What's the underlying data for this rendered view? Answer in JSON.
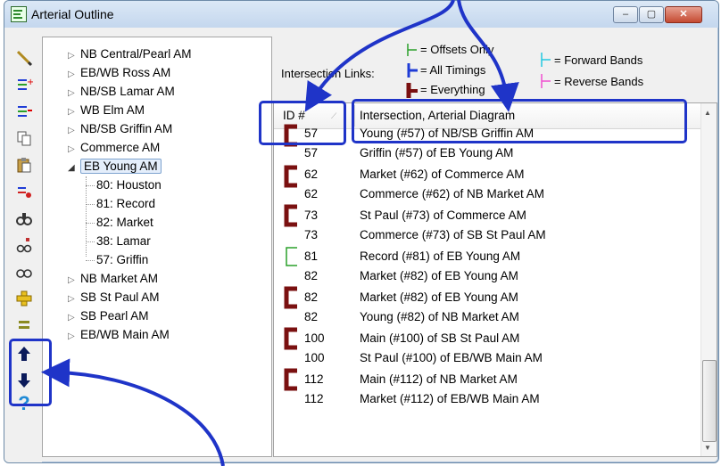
{
  "window": {
    "title": "Arterial Outline",
    "min": "–",
    "max": "▢",
    "close": "✕"
  },
  "tree": [
    {
      "label": "NB Central/Pearl AM"
    },
    {
      "label": "EB/WB Ross AM"
    },
    {
      "label": "NB/SB Lamar AM"
    },
    {
      "label": "WB Elm AM"
    },
    {
      "label": "NB/SB Griffin AM"
    },
    {
      "label": "Commerce AM"
    },
    {
      "label": "EB Young AM",
      "children": [
        "80: Houston",
        "81: Record",
        "82: Market",
        "38: Lamar",
        "57: Griffin"
      ]
    },
    {
      "label": "NB Market AM"
    },
    {
      "label": "SB St Paul AM"
    },
    {
      "label": "SB Pearl AM"
    },
    {
      "label": "EB/WB Main AM"
    }
  ],
  "legend": {
    "links_label": "Intersection Links:",
    "offsets": "= Offsets Only",
    "all": "= All Timings",
    "everything": "= Everything",
    "forward": "= Forward Bands",
    "reverse": "= Reverse Bands",
    "colors": {
      "offsets": "#2aa02a",
      "all": "#1f3cd6",
      "everything": "#7a1010",
      "forward": "#22c8e0",
      "reverse": "#f050d0"
    }
  },
  "list": {
    "headers": {
      "id": "ID #",
      "desc": "Intersection, Arterial Diagram"
    },
    "rows": [
      {
        "id": "57",
        "desc": "Young (#57) of NB/SB Griffin AM"
      },
      {
        "id": "57",
        "desc": "Griffin (#57) of EB Young AM"
      },
      {
        "id": "62",
        "desc": "Market (#62) of Commerce AM"
      },
      {
        "id": "62",
        "desc": "Commerce (#62) of NB Market AM"
      },
      {
        "id": "73",
        "desc": "St Paul (#73) of Commerce AM"
      },
      {
        "id": "73",
        "desc": "Commerce (#73) of SB St Paul AM"
      },
      {
        "id": "81",
        "desc": "Record (#81) of EB Young AM"
      },
      {
        "id": "82",
        "desc": "Market (#82) of EB Young AM"
      },
      {
        "id": "82",
        "desc": "Market (#82) of EB Young AM"
      },
      {
        "id": "82",
        "desc": "Young (#82) of NB Market AM"
      },
      {
        "id": "100",
        "desc": "Main (#100) of SB St Paul AM"
      },
      {
        "id": "100",
        "desc": "St Paul (#100) of EB/WB Main AM"
      },
      {
        "id": "112",
        "desc": "Main (#112) of NB Market AM"
      },
      {
        "id": "112",
        "desc": "Market (#112) of EB/WB Main AM"
      }
    ]
  },
  "toolbar": [
    "pencil-icon",
    "add-link-icon",
    "remove-link-icon",
    "copy-icon",
    "paste-icon",
    "transfer-icon",
    "binoculars-icon",
    "binoculars-alt-icon",
    "glasses-icon",
    "add-node-icon",
    "list-icon",
    "move-up-icon",
    "move-down-icon",
    "help-icon"
  ]
}
